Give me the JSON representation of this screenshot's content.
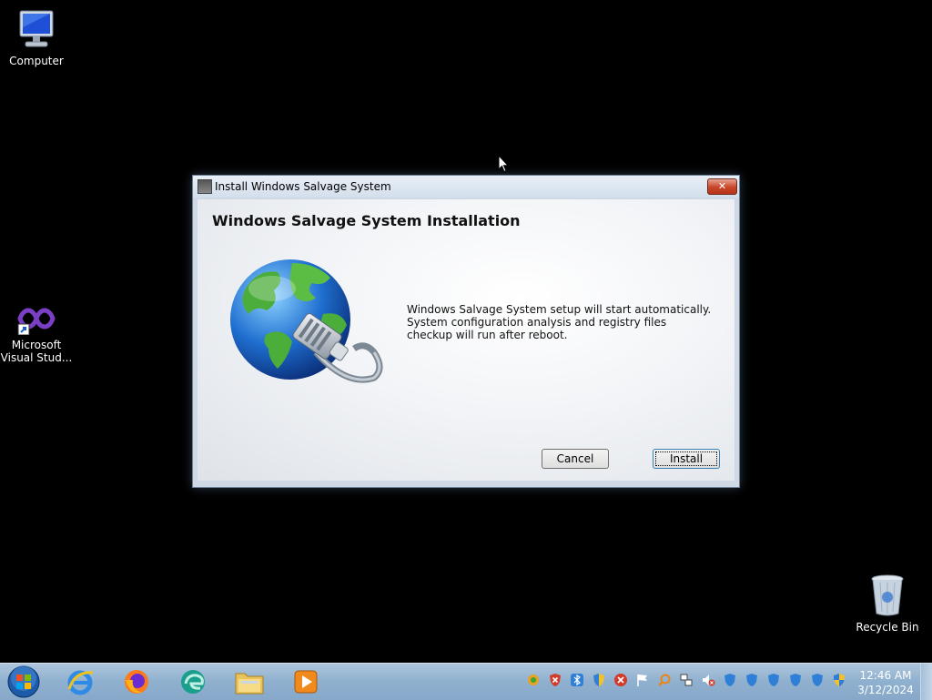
{
  "desktop": {
    "icons": [
      {
        "label": "Computer"
      },
      {
        "label": "Microsoft Visual Stud..."
      },
      {
        "label": "Recycle Bin"
      }
    ]
  },
  "dialog": {
    "title": "Install Windows Salvage System",
    "close_label": "✕",
    "heading": "Windows Salvage System Installation",
    "message_lines": [
      "Windows Salvage System setup will start automatically.",
      "System configuration analysis and registry files",
      "checkup will run after reboot."
    ],
    "cancel_label": "Cancel",
    "install_label": "Install"
  },
  "taskbar": {
    "pinned": [
      "internet-explorer-icon",
      "firefox-icon",
      "edge-icon",
      "file-explorer-icon",
      "media-player-icon"
    ],
    "tray_icons": [
      "antivirus-icon",
      "error-shield-icon",
      "bluetooth-icon",
      "security-shield-icon",
      "error-icon",
      "action-center-flag-icon",
      "search-icon",
      "network-icon",
      "volume-muted-icon",
      "shield-icon",
      "shield-icon",
      "shield-icon",
      "shield-icon",
      "shield-icon",
      "windows-security-icon"
    ],
    "clock": {
      "time": "12:46 AM",
      "date": "3/12/2024"
    }
  }
}
